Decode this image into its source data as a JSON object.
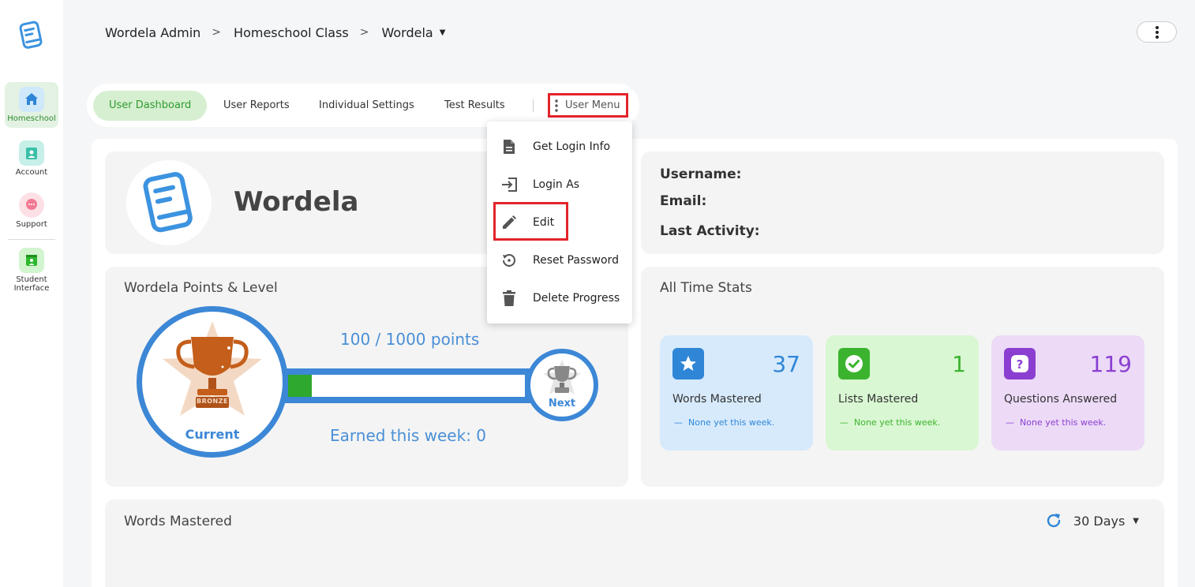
{
  "breadcrumb": {
    "items": [
      "Wordela Admin",
      "Homeschool Class",
      "Wordela"
    ],
    "separator": ">"
  },
  "sidebar": {
    "items": [
      {
        "label": "Homeschool",
        "icon": "home-icon",
        "active": true
      },
      {
        "label": "Account",
        "icon": "account-badge-icon"
      },
      {
        "label": "Support",
        "icon": "support-chat-icon"
      },
      {
        "label": "Student Interface",
        "icon": "student-interface-icon"
      }
    ]
  },
  "tabs": {
    "items": [
      "User Dashboard",
      "User Reports",
      "Individual Settings",
      "Test Results"
    ],
    "user_menu_label": "User Menu"
  },
  "dropdown": {
    "items": [
      {
        "label": "Get Login Info",
        "icon": "document-icon"
      },
      {
        "label": "Login As",
        "icon": "login-icon"
      },
      {
        "label": "Edit",
        "icon": "pencil-icon"
      },
      {
        "label": "Reset Password",
        "icon": "reset-icon"
      },
      {
        "label": "Delete Progress",
        "icon": "trash-icon"
      }
    ]
  },
  "profile": {
    "name": "Wordela"
  },
  "info": {
    "username_label": "Username:",
    "email_label": "Email:",
    "last_activity_label": "Last Activity:"
  },
  "points": {
    "title": "Wordela Points & Level",
    "points_text": "100 / 1000 points",
    "progress_fraction": 0.1,
    "earned_text": "Earned this week: 0",
    "current_label": "Current",
    "current_badge": "BRONZE",
    "next_label": "Next"
  },
  "stats": {
    "title": "All Time Stats",
    "tiles": [
      {
        "value": "37",
        "label": "Words Mastered",
        "week": "None yet this week.",
        "icon": "star-icon",
        "bg": "#d7eafc",
        "accent": "#2f86d6"
      },
      {
        "value": "1",
        "label": "Lists Mastered",
        "week": "None yet this week.",
        "icon": "check-icon",
        "bg": "#d9f7d2",
        "accent": "#3cb32f"
      },
      {
        "value": "119",
        "label": "Questions Answered",
        "week": "None yet this week.",
        "icon": "question-icon",
        "bg": "#ecdaf7",
        "accent": "#8b3fd1"
      }
    ]
  },
  "words_mastered": {
    "title": "Words Mastered",
    "range": "30 Days"
  },
  "colors": {
    "accent_blue": "#3c87d6",
    "accent_green": "#2ea82e",
    "highlight_red": "#e3242b"
  }
}
